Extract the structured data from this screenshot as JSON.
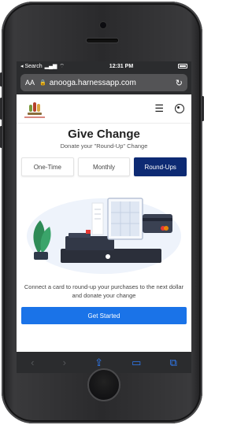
{
  "status_bar": {
    "carrier": "◂ Search",
    "time": "12:31 PM"
  },
  "browser": {
    "aa_label": "AA",
    "url": "anooga.harnessapp.com"
  },
  "header": {
    "logo_alt": "Harness logo",
    "icons": [
      "menu-icon",
      "user-icon"
    ]
  },
  "page": {
    "title": "Give Change",
    "subtitle": "Donate your \"Round-Up\" Change",
    "tabs": [
      {
        "label": "One-Time",
        "active": false
      },
      {
        "label": "Monthly",
        "active": false
      },
      {
        "label": "Round-Ups",
        "active": true
      }
    ],
    "description": "Connect a card to round-up your purchases to the next dollar and donate your change",
    "cta_label": "Get Started"
  },
  "toolbar": {
    "icons": [
      "back-icon",
      "forward-icon",
      "share-icon",
      "bookmarks-icon",
      "tabs-icon"
    ]
  },
  "colors": {
    "accent_dark": "#0d2a73",
    "accent_blue": "#1a73e8",
    "safari_dark": "#2b2c2e",
    "safari_blue": "#2f7cf6"
  }
}
